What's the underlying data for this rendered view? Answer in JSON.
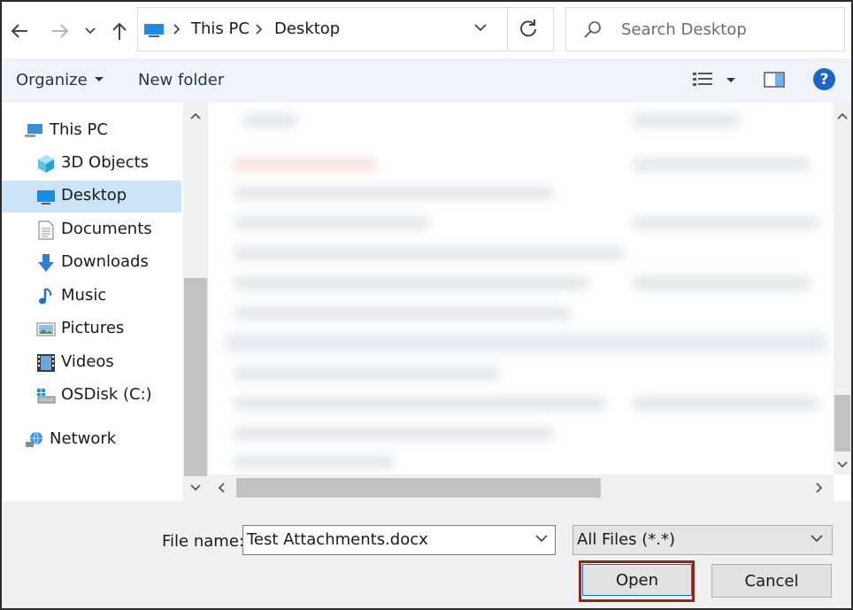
{
  "window": {
    "address": {
      "crumbs": [
        "This PC",
        "Desktop"
      ]
    },
    "search": {
      "placeholder": "Search Desktop"
    }
  },
  "toolbar": {
    "organize_label": "Organize",
    "new_folder_label": "New folder",
    "help_label": "?"
  },
  "sidebar": {
    "items": [
      {
        "label": "This PC",
        "icon": "pc-icon"
      },
      {
        "label": "3D Objects",
        "icon": "cube-icon"
      },
      {
        "label": "Desktop",
        "icon": "desktop-icon",
        "selected": true
      },
      {
        "label": "Documents",
        "icon": "document-icon"
      },
      {
        "label": "Downloads",
        "icon": "download-arrow-icon"
      },
      {
        "label": "Music",
        "icon": "music-note-icon"
      },
      {
        "label": "Pictures",
        "icon": "picture-icon"
      },
      {
        "label": "Videos",
        "icon": "film-icon"
      },
      {
        "label": "OSDisk (C:)",
        "icon": "drive-icon"
      },
      {
        "label": "Network",
        "icon": "network-icon"
      }
    ]
  },
  "footer": {
    "file_name_label": "File name:",
    "file_name_value": "Test Attachments.docx",
    "file_type_value": "All Files (*.*)",
    "open_label": "Open",
    "cancel_label": "Cancel"
  },
  "colors": {
    "selection": "#cce4f7",
    "help_blue": "#1a66c7",
    "highlight_border": "#8b2a14"
  }
}
